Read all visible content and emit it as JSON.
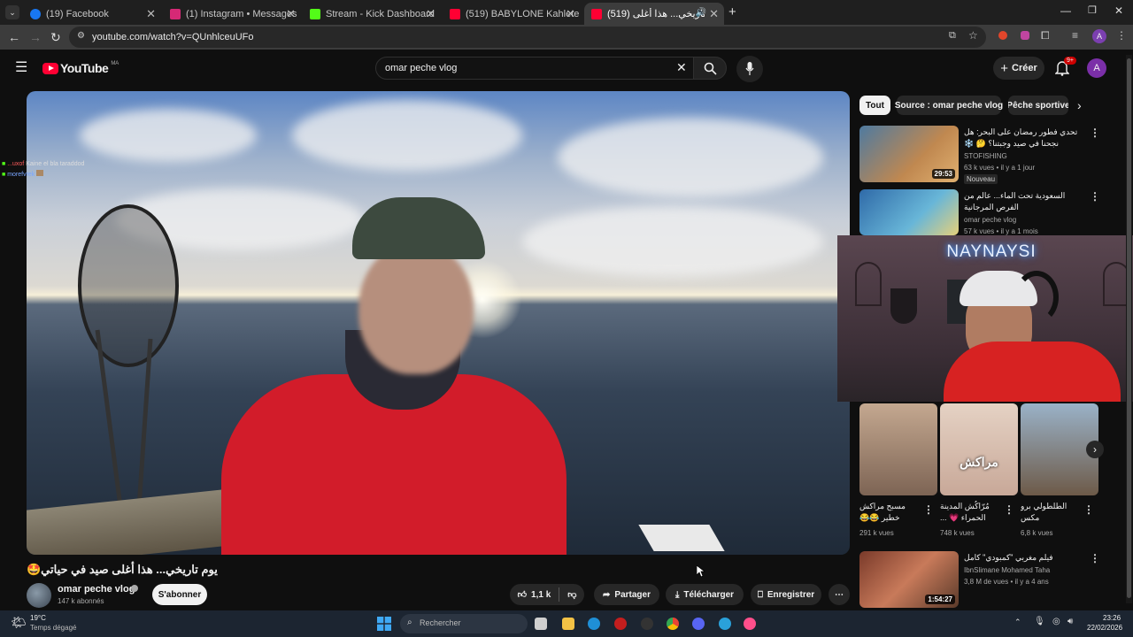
{
  "tabs": [
    {
      "label": "(19) Facebook",
      "color": "#1877f2"
    },
    {
      "label": "(1) Instagram • Messages",
      "color": "#d62976"
    },
    {
      "label": "Stream - Kick Dashboard",
      "color": "#53fc18"
    },
    {
      "label": "(519) BABYLONE Kahlete Laïyoun",
      "color": "#ff0033"
    },
    {
      "label": "(519) يوم تاريخي... هذا أغلى",
      "color": "#ff0033"
    }
  ],
  "address": {
    "url": "youtube.com/watch?v=QUnhlceuUFo"
  },
  "youtube": {
    "logo": "YouTube",
    "region": "MA",
    "search_value": "omar peche vlog",
    "create_label": "Créer",
    "notif_count": "9+",
    "avatar_letter": "A"
  },
  "video": {
    "title": "يوم تاريخي... هذا أغلى صيد في حياتي🤩",
    "channel": "omar peche vlog",
    "subscribers": "147 k abonnés",
    "subscribe_label": "S'abonner",
    "likes": "1,1 k",
    "share_label": "Partager",
    "download_label": "Télécharger",
    "save_label": "Enregistrer",
    "chat": [
      {
        "user": "...uxof",
        "msg": "Kaine el bla taraddod"
      },
      {
        "user": "morefvrek",
        "msg": ""
      }
    ]
  },
  "chips": [
    "Tout",
    "Source : omar peche vlog",
    "Pêche sportive"
  ],
  "recommendations": [
    {
      "title": "تحدي فطور رمضان على البحر: هل نجحنا في صيد وجبتنا؟ 🤔 ❄️",
      "channel": "STOFISHING",
      "meta": "63 k vues • il y a 1 jour",
      "badge": "Nouveau",
      "duration": "29:53"
    },
    {
      "title": "السعودية تحت الماء... عالم من الفرص المرجانية",
      "channel": "omar peche vlog",
      "meta": "57 k vues • il y a 1 mois",
      "badge": "",
      "duration": ""
    }
  ],
  "shorts": [
    {
      "title": "مسبح مراكش خطير 😂😂",
      "views": "291 k vues"
    },
    {
      "title": "مُرّاكُش المدينة الحمراء 💗 ...",
      "views": "748 k vues"
    },
    {
      "title": "الطلطولي برو مكس",
      "views": "6,8 k vues"
    }
  ],
  "shorts_overlay_text": "مراكش",
  "last_rec": {
    "title": "فيلم مغربي \"كمبودي\" كامل",
    "channel": "IbnSlimane Mohamed Taha",
    "meta": "3,8 M de vues • il y a 4 ans",
    "duration": "1:54:27"
  },
  "webcam": {
    "sign": "NAYNAYSI"
  },
  "taskbar": {
    "temp": "19°C",
    "weather": "Temps dégagé",
    "search_placeholder": "Rechercher",
    "time": "23:26",
    "date": "22/02/2026"
  }
}
